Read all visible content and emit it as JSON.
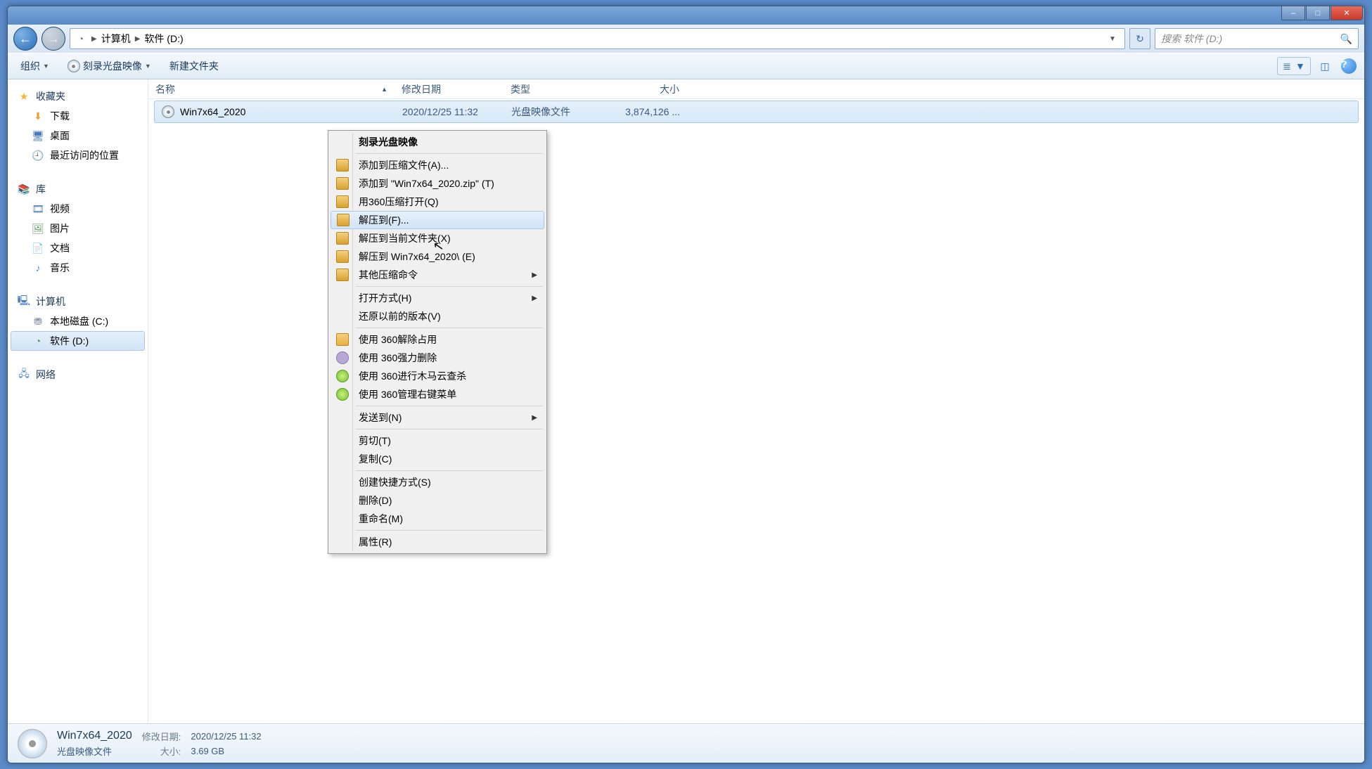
{
  "titlebar": {
    "min": "–",
    "max": "□",
    "close": "✕"
  },
  "navbar": {
    "back_arrow": "←",
    "fwd_arrow": "→",
    "crumb1": "计算机",
    "crumb2": "软件 (D:)",
    "refresh": "↻",
    "search_placeholder": "搜索 软件 (D:)"
  },
  "toolbar": {
    "organize": "组织",
    "burn": "刻录光盘映像",
    "new_folder": "新建文件夹",
    "help": "?"
  },
  "sidebar": {
    "favorites": "收藏夹",
    "downloads": "下载",
    "desktop": "桌面",
    "recent": "最近访问的位置",
    "libraries": "库",
    "videos": "视频",
    "pictures": "图片",
    "documents": "文档",
    "music": "音乐",
    "computer": "计算机",
    "local_c": "本地磁盘 (C:)",
    "local_d": "软件 (D:)",
    "network": "网络"
  },
  "columns": {
    "name": "名称",
    "date": "修改日期",
    "type": "类型",
    "size": "大小"
  },
  "file": {
    "name": "Win7x64_2020",
    "date": "2020/12/25 11:32",
    "type": "光盘映像文件",
    "size": "3,874,126 ..."
  },
  "context_menu": {
    "burn_image": "刻录光盘映像",
    "add_to_archive": "添加到压缩文件(A)...",
    "add_to_zip": "添加到 \"Win7x64_2020.zip\" (T)",
    "open_360zip": "用360压缩打开(Q)",
    "extract_to": "解压到(F)...",
    "extract_here": "解压到当前文件夹(X)",
    "extract_named": "解压到 Win7x64_2020\\ (E)",
    "other_zip": "其他压缩命令",
    "open_with": "打开方式(H)",
    "restore_prev": "还原以前的版本(V)",
    "unlock_360": "使用 360解除占用",
    "force_del_360": "使用 360强力删除",
    "scan_360": "使用 360进行木马云查杀",
    "manage_menu_360": "使用 360管理右键菜单",
    "send_to": "发送到(N)",
    "cut": "剪切(T)",
    "copy": "复制(C)",
    "create_shortcut": "创建快捷方式(S)",
    "delete": "删除(D)",
    "rename": "重命名(M)",
    "properties": "属性(R)"
  },
  "details": {
    "name": "Win7x64_2020",
    "type": "光盘映像文件",
    "date_label": "修改日期:",
    "date_val": "2020/12/25 11:32",
    "size_label": "大小:",
    "size_val": "3.69 GB"
  }
}
